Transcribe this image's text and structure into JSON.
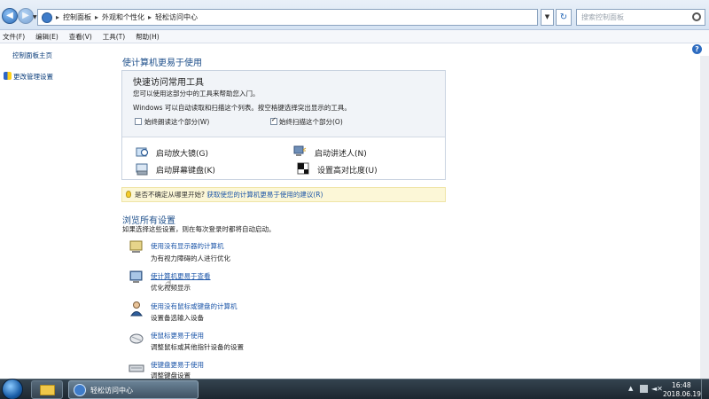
{
  "address": {
    "crumbs": [
      "控制面板",
      "外观和个性化",
      "轻松访问中心"
    ],
    "search_placeholder": "搜索控制面板"
  },
  "menu": [
    "文件(F)",
    "编辑(E)",
    "查看(V)",
    "工具(T)",
    "帮助(H)"
  ],
  "left": {
    "home": "控制面板主页",
    "admin": "更改管理设置"
  },
  "main": {
    "title": "使计算机更易于使用",
    "quick": {
      "title": "快速访问常用工具",
      "desc1": "您可以使用这部分中的工具来帮助您入门。",
      "desc2": "Windows 可以自动读取和扫描这个列表。按空格键选择突出显示的工具。",
      "check1": "始终朗读这个部分(W)",
      "check2": "始终扫描这个部分(O)",
      "tools": {
        "magnifier": "启动放大镜(G)",
        "narrator": "启动讲述人(N)",
        "keyboard": "启动屏幕键盘(K)",
        "contrast": "设置高对比度(U)"
      }
    },
    "tip": {
      "question": "是否不确定从哪里开始?",
      "link": "获取使您的计算机更易于使用的建议(R)"
    },
    "browse": {
      "title": "浏览所有设置",
      "desc": "如果选择这些设置，则在每次登录时都将自动启动。",
      "items": [
        {
          "link": "使用没有显示器的计算机",
          "desc": "为有视力障碍的人进行优化",
          "icon": "no-display-icon"
        },
        {
          "link": "使计算机更易于查看",
          "desc": "优化视频显示",
          "icon": "monitor-icon"
        },
        {
          "link": "使用没有鼠标或键盘的计算机",
          "desc": "设置备选输入设备",
          "icon": "user-icon"
        },
        {
          "link": "使鼠标更易于使用",
          "desc": "调整鼠标或其他指针设备的设置",
          "icon": "mouse-icon"
        },
        {
          "link": "使键盘更易于使用",
          "desc": "调整键盘设置",
          "icon": "keyboard-icon"
        }
      ]
    }
  },
  "taskbar": {
    "ease_label": "轻松访问中心",
    "time": "16:48",
    "date": "2018.06.19"
  }
}
